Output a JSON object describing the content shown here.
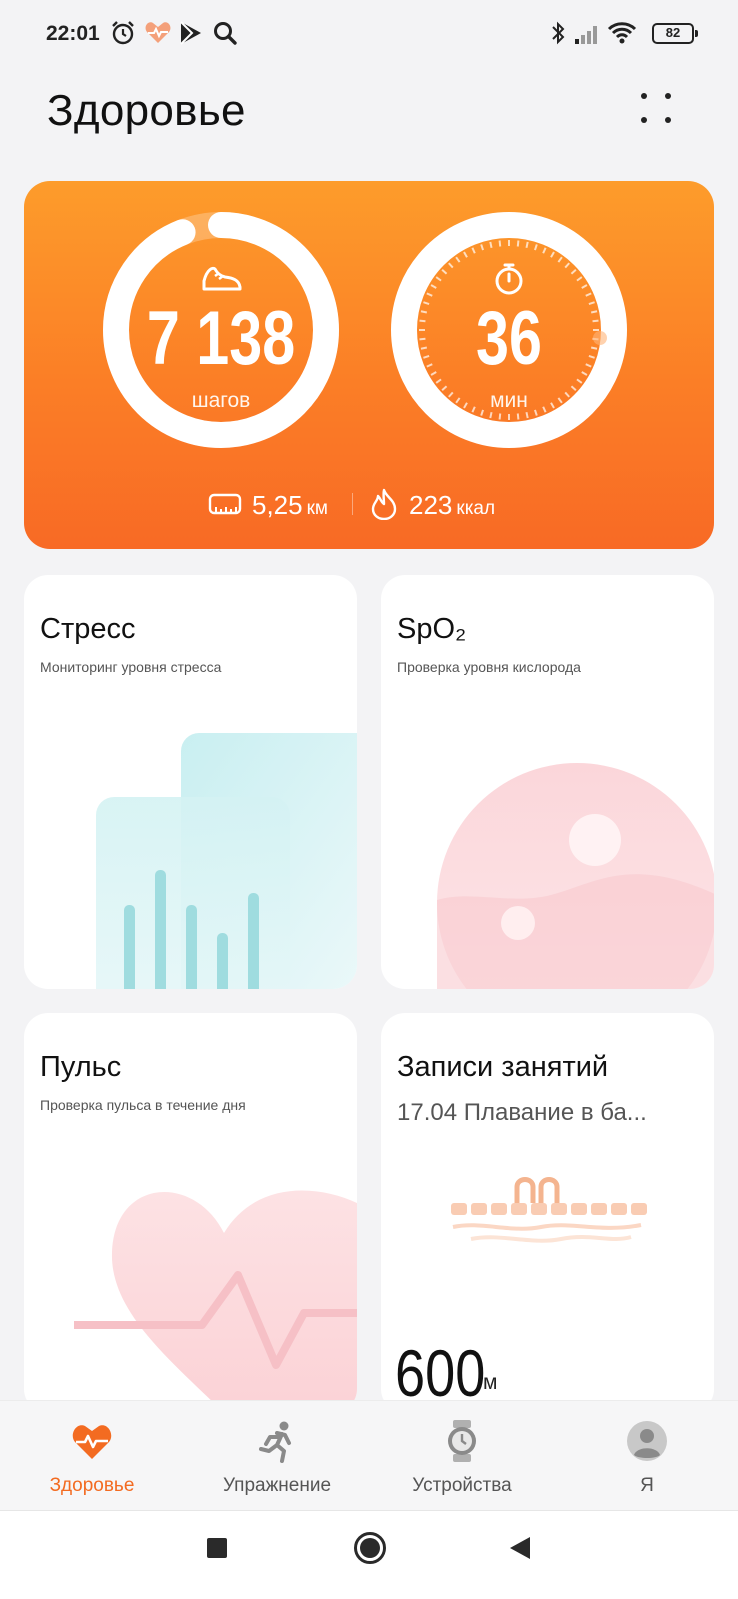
{
  "status_bar": {
    "time": "22:01",
    "icons": [
      "alarm-icon",
      "health-icon",
      "play-icon",
      "search-icon"
    ],
    "right_icons": [
      "bluetooth-icon",
      "signal-icon",
      "wifi-icon"
    ],
    "battery": "82"
  },
  "header": {
    "title": "Здоровье",
    "menu_icon": "grid-dots-icon"
  },
  "activity": {
    "steps_value": "7 138",
    "steps_unit": "шагов",
    "steps_progress": 0.94,
    "minutes_value": "36",
    "minutes_unit": "мин",
    "distance_value": "5,25",
    "distance_unit": "км",
    "calories_value": "223",
    "calories_unit": "ккал",
    "colors": {
      "card_top": "#fd9c2b",
      "card_bottom": "#f86a25"
    }
  },
  "tiles": {
    "stress": {
      "title": "Стресс",
      "subtitle": "Мониторинг уровня стресса"
    },
    "spo2": {
      "title": "SpO₂",
      "subtitle": "Проверка уровня кислорода"
    },
    "pulse": {
      "title": "Пульс",
      "subtitle": "Проверка пульса в течение дня"
    },
    "workouts": {
      "title": "Записи занятий",
      "subtitle": "17.04 Плавание в ба...",
      "metric": "600",
      "metric_unit": "м"
    }
  },
  "tabbar": {
    "active_color": "#f36b21",
    "tabs": [
      {
        "label": "Здоровье",
        "icon": "heart-pulse-icon",
        "active": true
      },
      {
        "label": "Упражнение",
        "icon": "runner-icon",
        "active": false
      },
      {
        "label": "Устройства",
        "icon": "watch-icon",
        "active": false
      },
      {
        "label": "Я",
        "icon": "profile-icon",
        "active": false
      }
    ]
  },
  "system_nav": {
    "buttons": [
      "recents-button",
      "home-button",
      "back-button"
    ]
  }
}
